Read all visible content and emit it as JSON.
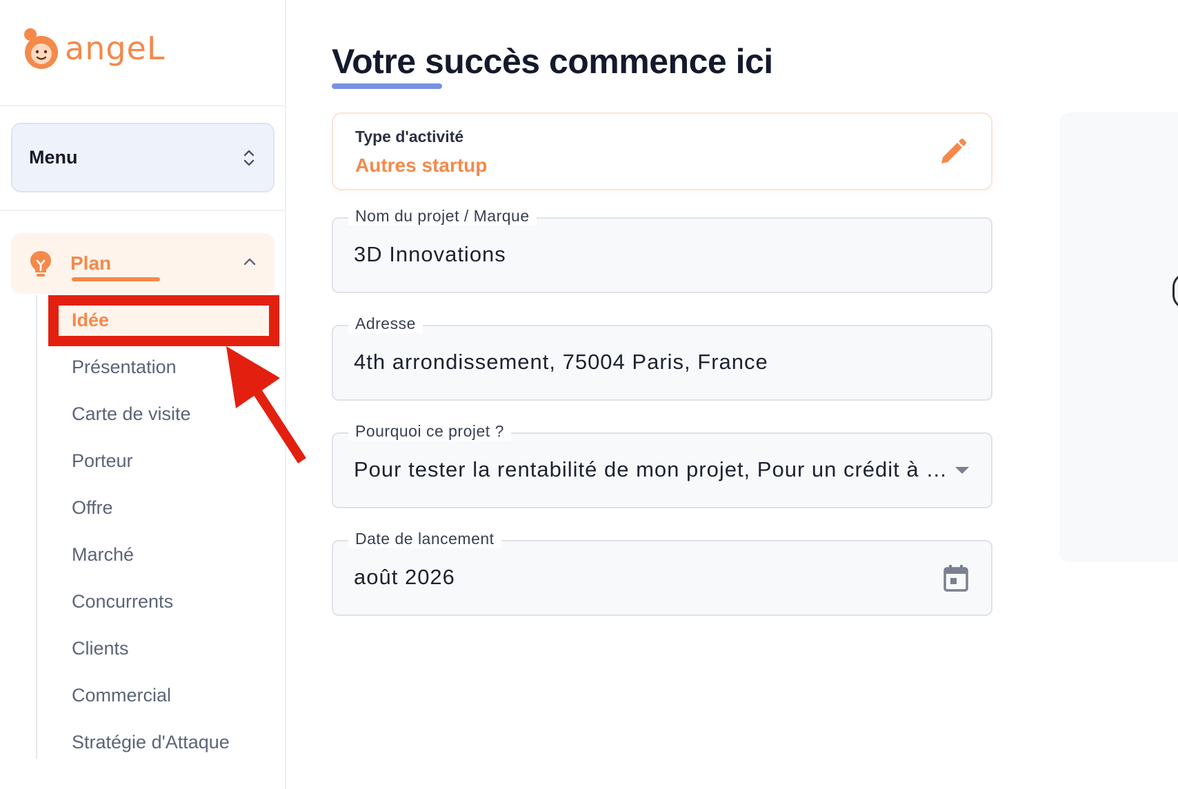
{
  "brand": {
    "name": "angeL",
    "color": "#f4894a"
  },
  "sidebar": {
    "menu_select": {
      "label": "Menu",
      "icon": "chevron-updown-icon"
    },
    "section": {
      "label": "Plan",
      "icon": "lightbulb-icon",
      "expanded": true
    },
    "items": [
      {
        "label": "Idée",
        "active": true
      },
      {
        "label": "Présentation"
      },
      {
        "label": "Carte de visite"
      },
      {
        "label": "Porteur"
      },
      {
        "label": "Offre"
      },
      {
        "label": "Marché"
      },
      {
        "label": "Concurrents"
      },
      {
        "label": "Clients"
      },
      {
        "label": "Commercial"
      },
      {
        "label": "Stratégie d'Attaque"
      }
    ]
  },
  "main": {
    "title": "Votre succès commence ici",
    "activity": {
      "label": "Type d'activité",
      "value": "Autres startup",
      "icon": "pencil-icon"
    },
    "fields": {
      "project_name": {
        "label": "Nom du projet / Marque",
        "value": "3D Innovations"
      },
      "address": {
        "label": "Adresse",
        "value": "4th arrondissement, 75004 Paris, France"
      },
      "why": {
        "label": "Pourquoi ce projet ?",
        "value": "Pour tester la rentabilité de mon projet, Pour un crédit à …",
        "icon": "caret-down-icon"
      },
      "launch_date": {
        "label": "Date de lancement",
        "value": "août 2026",
        "icon": "calendar-icon"
      }
    }
  },
  "colors": {
    "accent": "#f4894a",
    "title_underline": "#7791e3",
    "annotation": "#e3200f"
  }
}
